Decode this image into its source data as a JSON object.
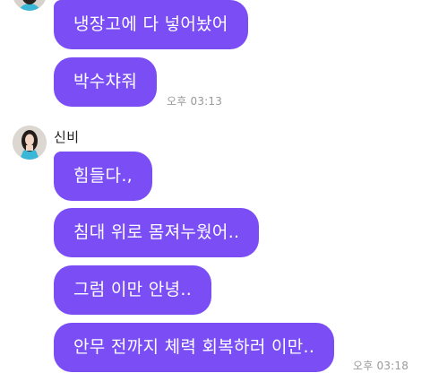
{
  "theme": {
    "bubble_color": "#7a4df5",
    "bubble_text_color": "#ffffff",
    "time_color": "#9a9a9a",
    "background": "#ffffff"
  },
  "groups": [
    {
      "sender": "",
      "avatar_icon": "profile-photo-avatar",
      "messages": [
        {
          "text": "냉장고에 다 넣어놨어"
        },
        {
          "text": "박수챠줘",
          "time": "오후 03:13"
        }
      ]
    },
    {
      "sender": "신비",
      "avatar_icon": "profile-photo-avatar",
      "messages": [
        {
          "text": "힘들다.,"
        },
        {
          "text": "침대 위로 몸져누웠어.."
        },
        {
          "text": "그럼 이만 안녕.."
        },
        {
          "text": "안무 전까지 체력 회복하러 이만..",
          "time": "오후 03:18"
        }
      ]
    }
  ]
}
